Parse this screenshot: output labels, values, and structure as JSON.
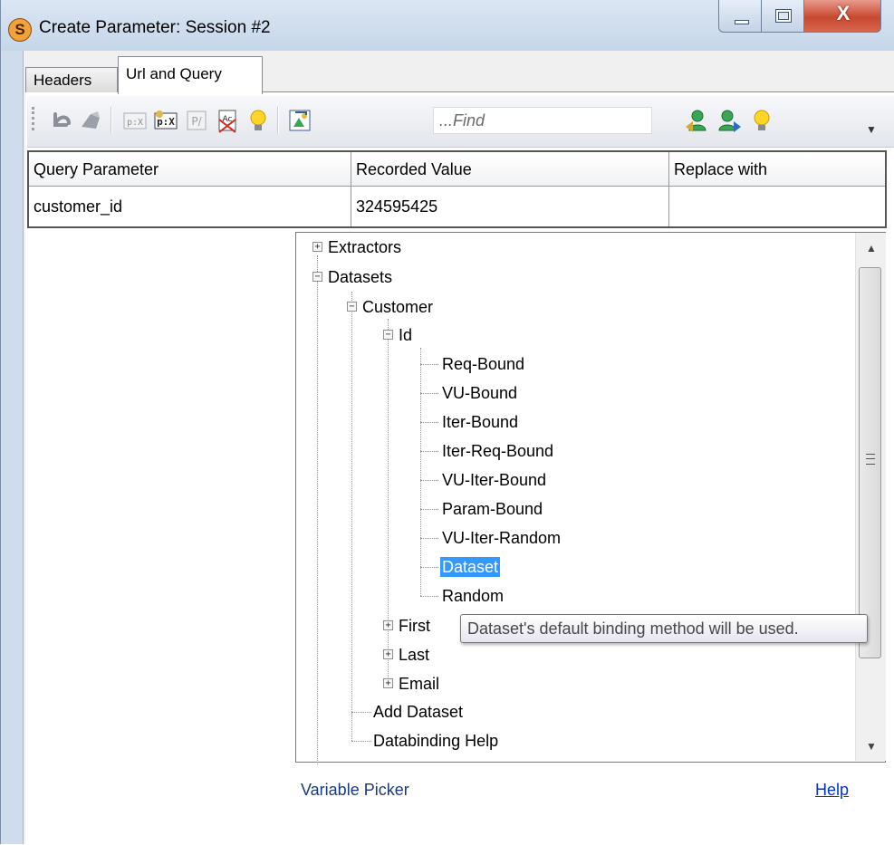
{
  "window": {
    "title": "Create Parameter: Session #2",
    "app_icon_letter": "S",
    "close_glyph": "X"
  },
  "tabs": [
    {
      "label": "Headers",
      "active": false
    },
    {
      "label": "Url and Query",
      "active": true
    }
  ],
  "toolbar": {
    "find_placeholder": "...Find",
    "buttons": [
      "undo-icon",
      "redo-icon",
      "extract-variable-icon",
      "extract-variable-bold-icon",
      "parameter-icon",
      "spellcheck-icon",
      "hint-bulb-icon",
      "insert-file-icon",
      "find-next-icon",
      "find-previous-icon",
      "help-bulb-icon"
    ]
  },
  "grid": {
    "headers": [
      "Query Parameter",
      "Recorded Value",
      "Replace with"
    ],
    "rows": [
      {
        "param": "customer_id",
        "value": "324595425",
        "replace": ""
      }
    ]
  },
  "tree": {
    "extractors": "Extractors",
    "datasets": "Datasets",
    "customer": "Customer",
    "id": "Id",
    "bindings": [
      "Req-Bound",
      "VU-Bound",
      "Iter-Bound",
      "Iter-Req-Bound",
      "VU-Iter-Bound",
      "Param-Bound",
      "VU-Iter-Random",
      "Dataset",
      "Random"
    ],
    "selected": "Dataset",
    "first": "First",
    "last": "Last",
    "email": "Email",
    "add_dataset": "Add Dataset",
    "databinding_help": "Databinding Help"
  },
  "tooltip": "Dataset's default binding method will be used.",
  "footer": {
    "variable_picker": "Variable Picker",
    "help": "Help"
  },
  "colors": {
    "selection": "#3399ff",
    "link": "#0033cc",
    "label": "#1a3a78"
  }
}
